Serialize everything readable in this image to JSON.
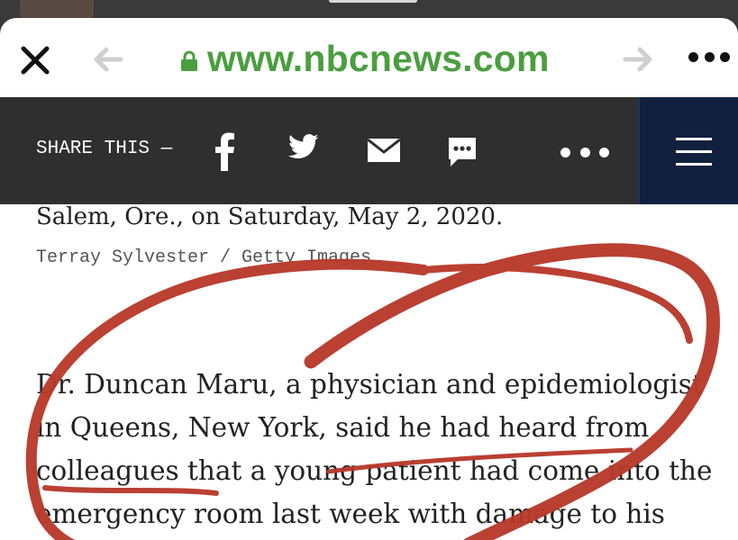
{
  "browser": {
    "url": "www.nbcnews.com",
    "icons": {
      "close": "close-icon",
      "back": "arrow-left-icon",
      "forward": "arrow-right-icon",
      "lock": "lock-icon",
      "more": "more-dots-icon"
    }
  },
  "share_bar": {
    "label": "SHARE THIS —",
    "icons": [
      "facebook-icon",
      "twitter-icon",
      "mail-icon",
      "sms-icon",
      "more-dots-icon",
      "hamburger-menu-icon"
    ]
  },
  "article": {
    "caption": "Salem, Ore., on Saturday, May 2, 2020.",
    "credit": "Terray Sylvester / Getty Images",
    "body_lines": [
      "Dr. Duncan Maru, a physician and epidemiologist",
      "in Queens, New York, said he had heard from",
      "colleagues that a young patient had come into the",
      "emergency room last week with damage to his"
    ]
  },
  "colors": {
    "url_green": "#4a9e3f",
    "share_bar_bg": "#2f2f2f",
    "menu_bg": "#11203e",
    "annotation_red": "#b8392a"
  }
}
